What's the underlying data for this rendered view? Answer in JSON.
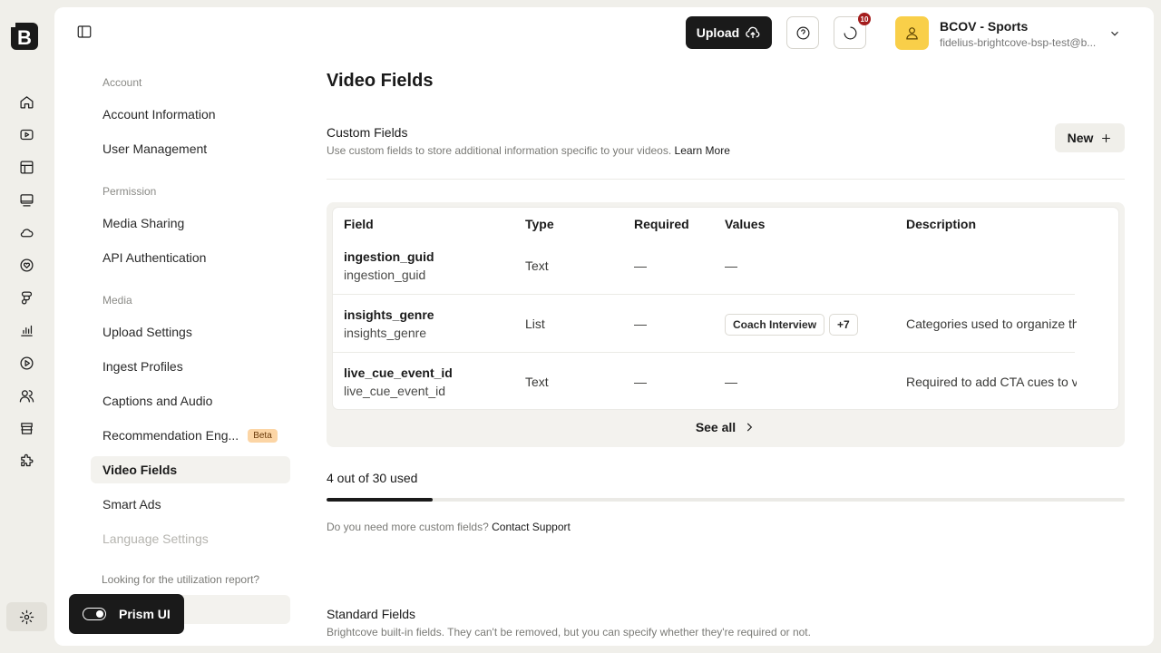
{
  "header": {
    "upload_label": "Upload",
    "notification_count": "10",
    "account_name": "BCOV - Sports",
    "account_email": "fidelius-brightcove-bsp-test@b..."
  },
  "nav": {
    "sections": [
      {
        "title": "Account",
        "items": [
          "Account Information",
          "User Management"
        ]
      },
      {
        "title": "Permission",
        "items": [
          "Media Sharing",
          "API Authentication"
        ]
      },
      {
        "title": "Media",
        "items": [
          "Upload Settings",
          "Ingest Profiles",
          "Captions and Audio",
          "Recommendation Eng...",
          "Video Fields",
          "Smart Ads",
          "Language Settings"
        ]
      }
    ],
    "beta_label": "Beta",
    "utilization_note": "Looking for the utilization report?",
    "active_item": "Video Fields"
  },
  "page": {
    "title": "Video Fields",
    "custom": {
      "title": "Custom Fields",
      "desc": "Use custom fields to store additional information specific to your videos.",
      "learn_more": "Learn More",
      "new_label": "New"
    },
    "table": {
      "headers": [
        "Field",
        "Type",
        "Required",
        "Values",
        "Description"
      ],
      "rows": [
        {
          "name": "ingestion_guid",
          "key": "ingestion_guid",
          "type": "Text",
          "required": "—",
          "values": "—",
          "description": ""
        },
        {
          "name": "insights_genre",
          "key": "insights_genre",
          "type": "List",
          "required": "—",
          "chip": "Coach Interview",
          "chip_more": "+7",
          "description": "Categories used to organize th"
        },
        {
          "name": "live_cue_event_id",
          "key": "live_cue_event_id",
          "type": "Text",
          "required": "—",
          "values": "—",
          "description": "Required to add CTA cues to v"
        }
      ],
      "see_all": "See all"
    },
    "usage": {
      "label": "4 out of 30 used",
      "used": 4,
      "total": 30
    },
    "more": {
      "text": "Do you need more custom fields?",
      "link": "Contact Support"
    },
    "standard": {
      "title": "Standard Fields",
      "desc": "Brightcove built-in fields. They can't be removed, but you can specify whether they're required or not."
    }
  },
  "prism": {
    "label": "Prism UI"
  },
  "icons": [
    "logo-icon",
    "home-icon",
    "video-icon",
    "layout-icon",
    "player-icon",
    "cloud-icon",
    "heart-icon",
    "social-icon",
    "analytics-icon",
    "play-icon",
    "users-icon",
    "store-icon",
    "plugin-icon",
    "settings-icon"
  ]
}
